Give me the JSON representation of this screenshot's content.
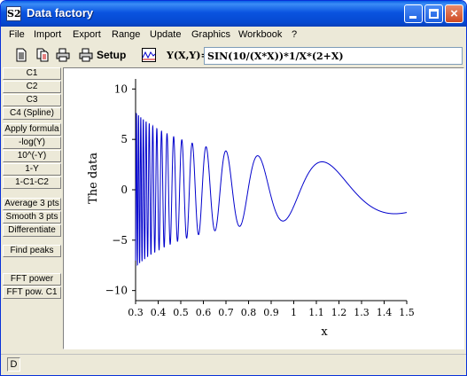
{
  "window": {
    "title": "Data factory",
    "app_icon_text": "S2"
  },
  "title_buttons": {
    "close": "×"
  },
  "menu": [
    {
      "label": "File"
    },
    {
      "label": "Import"
    },
    {
      "label": "Export"
    },
    {
      "label": "Range"
    },
    {
      "label": "Update"
    },
    {
      "label": "Graphics"
    },
    {
      "label": "Workbook"
    },
    {
      "label": "?"
    }
  ],
  "toolbar": {
    "icons": [
      "new-document-icon",
      "copy-document-icon",
      "print-icon",
      "printer-setup-icon",
      "graph-icon"
    ],
    "setup_label": "Setup",
    "formula_label": "Y(X,Y)=",
    "formula_value": "SIN(10/(X*X))*1/X*(2+X)"
  },
  "side_buttons": [
    {
      "label": "C1"
    },
    {
      "label": "C2"
    },
    {
      "label": "C3"
    },
    {
      "label": "C4 (Spline)"
    },
    {
      "label": "Apply formula"
    },
    {
      "label": "-log(Y)"
    },
    {
      "label": "10^(-Y)"
    },
    {
      "label": "1-Y"
    },
    {
      "label": "1-C1-C2"
    },
    {
      "label": "Average 3 pts"
    },
    {
      "label": "Smooth 3 pts"
    },
    {
      "label": "Differentiate"
    },
    {
      "label": "Find peaks"
    },
    {
      "label": "FFT power"
    },
    {
      "label": "FFT pow. C1"
    }
  ],
  "status": {
    "indicator": "D"
  },
  "colors": {
    "line": "#0000cc",
    "titlebar": "#0a54e0",
    "panel": "#ece9d8"
  },
  "chart_data": {
    "type": "line",
    "xlabel": "x",
    "ylabel": "The data",
    "xlim": [
      0.3,
      1.5
    ],
    "ylim": [
      -11,
      11
    ],
    "xticks": [
      0.3,
      0.4,
      0.5,
      0.6,
      0.7,
      0.8,
      0.9,
      1.0,
      1.1,
      1.2,
      1.3,
      1.4,
      1.5
    ],
    "yticks": [
      -10,
      -5,
      0,
      5,
      10
    ],
    "grid": false,
    "series": [
      {
        "formula": "sin(10/(x*x))*(1/x)*(2+x)",
        "x_start": 0.3,
        "x_end": 1.5
      }
    ]
  }
}
